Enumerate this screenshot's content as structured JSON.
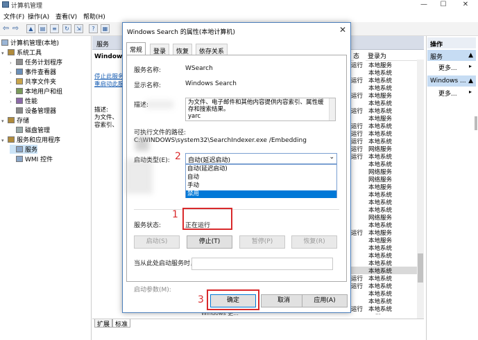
{
  "window": {
    "title": "计算机管理",
    "minimize": "—",
    "maximize": "☐",
    "close": "✕"
  },
  "menu": [
    "文件(F)",
    "操作(A)",
    "查看(V)",
    "帮助(H)"
  ],
  "tree": {
    "root": "计算机管理(本地)",
    "items": [
      {
        "label": "系统工具",
        "level": 1,
        "arrow": "▾"
      },
      {
        "label": "任务计划程序",
        "level": 2,
        "arrow": "›"
      },
      {
        "label": "事件查看器",
        "level": 2,
        "arrow": "›"
      },
      {
        "label": "共享文件夹",
        "level": 2,
        "arrow": "›"
      },
      {
        "label": "本地用户和组",
        "level": 2,
        "arrow": "›"
      },
      {
        "label": "性能",
        "level": 2,
        "arrow": "›"
      },
      {
        "label": "设备管理器",
        "level": 2,
        "arrow": ""
      },
      {
        "label": "存储",
        "level": 1,
        "arrow": "▾"
      },
      {
        "label": "磁盘管理",
        "level": 2,
        "arrow": ""
      },
      {
        "label": "服务和应用程序",
        "level": 1,
        "arrow": "▾"
      },
      {
        "label": "服务",
        "level": 2,
        "arrow": "",
        "selected": true
      },
      {
        "label": "WMI 控件",
        "level": 2,
        "arrow": ""
      }
    ]
  },
  "center": {
    "header": "服务",
    "panel_title": "Windows",
    "link_stop": "停止此服务",
    "link_restart": "重启动此服务",
    "desc_label": "描述:",
    "desc_text_1": "为文件、",
    "desc_text_2": "容索引、",
    "col_login": "登录为",
    "col_status_fragment": "态",
    "rows": [
      {
        "status": "",
        "login": "本地服务"
      },
      {
        "status": "",
        "login": "本地系统"
      },
      {
        "status": "",
        "login": "本地系统"
      },
      {
        "status": "",
        "login": "本地系统"
      },
      {
        "status": "",
        "login": "本地服务"
      },
      {
        "status": "",
        "login": "本地系统"
      },
      {
        "status": "",
        "login": "本地系统"
      },
      {
        "status": "",
        "login": "本地服务"
      },
      {
        "status": "",
        "login": "本地系统"
      },
      {
        "status": "",
        "login": "本地系统"
      },
      {
        "status": "",
        "login": "本地系统"
      },
      {
        "status": "",
        "login": "网络服务"
      },
      {
        "status": "",
        "login": "本地系统"
      },
      {
        "status": "",
        "login": "本地系统"
      },
      {
        "status": "",
        "login": "网络服务"
      },
      {
        "status": "",
        "login": "网络服务"
      },
      {
        "status": "",
        "login": "本地服务"
      },
      {
        "status": "",
        "login": "本地系统"
      },
      {
        "status": "",
        "login": "本地系统"
      },
      {
        "status": "",
        "login": "本地系统"
      },
      {
        "status": "",
        "login": "网络服务"
      },
      {
        "status": "",
        "login": "本地系统"
      },
      {
        "status": "",
        "login": "本地服务"
      },
      {
        "status": "",
        "login": "本地服务"
      },
      {
        "status": "",
        "login": "本地系统"
      },
      {
        "status": "",
        "login": "本地系统"
      },
      {
        "status": "",
        "login": "本地系统"
      },
      {
        "status": "",
        "login": "本地系统"
      },
      {
        "status": "",
        "login": "本地系统"
      },
      {
        "status": "",
        "login": "本地系统"
      },
      {
        "status": "",
        "login": "本地系统"
      },
      {
        "status": "",
        "login": "本地系统"
      },
      {
        "status": "",
        "login": "本地系统"
      },
      {
        "status": "",
        "login": "本地系统"
      }
    ],
    "status_fragments": [
      "运行",
      "",
      "运行",
      "",
      "运行",
      "",
      "运行",
      "",
      "运行",
      "运行",
      "运行",
      "运行",
      "运行",
      "",
      "",
      "",
      "",
      "",
      "",
      "",
      "",
      "",
      "运行",
      "",
      "",
      "",
      "",
      "",
      "运行",
      "运行",
      "",
      "",
      "运行",
      "运行"
    ],
    "bottom_row_text": "Windows 更...",
    "bottom_row_trail": "...",
    "tab_extended": "扩展",
    "tab_standard": "标准"
  },
  "actions": {
    "header": "操作",
    "group1": "服务",
    "more1": "更多...",
    "group2": "Windows ...",
    "more2": "更多...",
    "arrow": "▲",
    "chevron": "▸"
  },
  "dialog": {
    "title": "Windows Search 的属性(本地计算机)",
    "close": "✕",
    "tabs": [
      "常规",
      "登录",
      "恢复",
      "依存关系"
    ],
    "service_name_label": "服务名称:",
    "service_name": "WSearch",
    "display_name_label": "显示名称:",
    "display_name": "Windows Search",
    "desc_label": "描述:",
    "description": "为文件、电子邮件和其他内容提供内容索引、属性缓存和搜索结果。",
    "description_tail": "yarc",
    "path_label": "可执行文件的路径:",
    "path": "C:\\WINDOWS\\system32\\SearchIndexer.exe /Embedding",
    "startup_label": "启动类型(E):",
    "startup_value": "自动(延迟启动)",
    "startup_options": [
      "自动(延迟启动)",
      "自动",
      "手动",
      "禁用"
    ],
    "status_label": "服务状态:",
    "status_value": "正在运行",
    "btn_start": "启动(S)",
    "btn_stop": "停止(T)",
    "btn_pause": "暂停(P)",
    "btn_resume": "恢复(R)",
    "hint": "当从此处启动服务时，你可指定所适用的启动参数。",
    "params_label": "启动参数(M):",
    "btn_ok": "确定",
    "btn_cancel": "取消",
    "btn_apply": "应用(A)"
  },
  "annotations": {
    "n1": "1",
    "n2": "2",
    "n3": "3",
    "color": "#d9292b"
  }
}
